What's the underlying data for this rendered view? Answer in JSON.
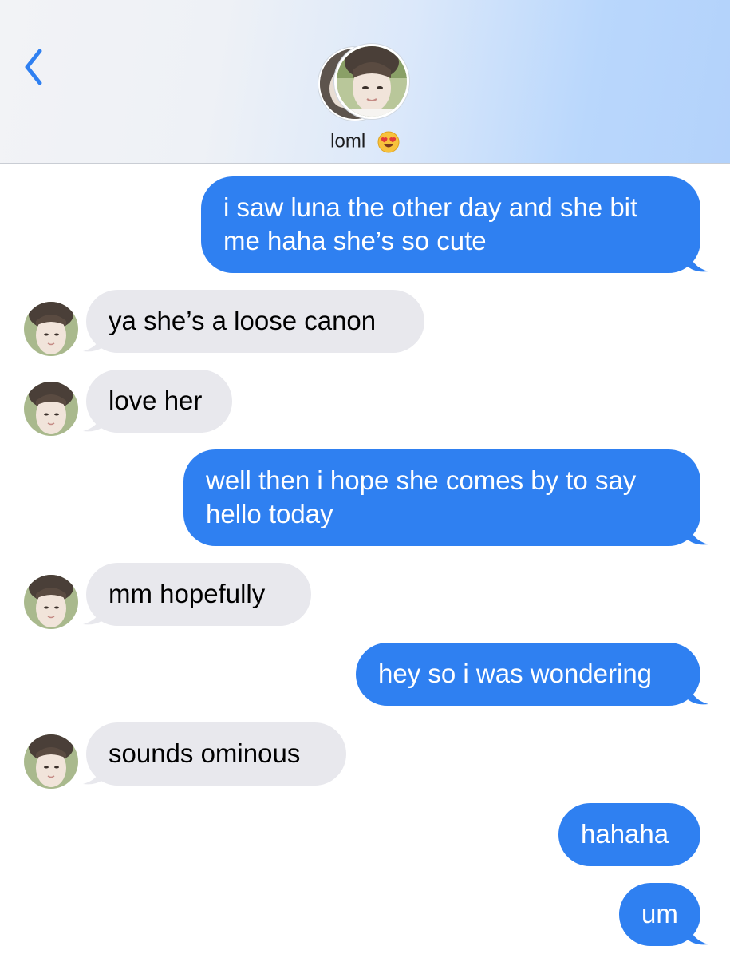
{
  "header": {
    "back_icon": "chevron-left-icon",
    "contact_name": "loml",
    "contact_emoji": "heart-eyes-emoji",
    "accent_color": "#2f80f1"
  },
  "messages": [
    {
      "id": "m1",
      "direction": "outgoing",
      "lines": [
        "i saw luna the other day and she bit",
        "me haha she’s so cute"
      ]
    },
    {
      "id": "m2",
      "direction": "incoming",
      "lines": [
        "ya she’s a loose canon"
      ]
    },
    {
      "id": "m3",
      "direction": "incoming",
      "lines": [
        "love her"
      ]
    },
    {
      "id": "m4",
      "direction": "outgoing",
      "lines": [
        "well then i hope she comes by to say",
        "hello today"
      ]
    },
    {
      "id": "m5",
      "direction": "incoming",
      "lines": [
        "mm hopefully"
      ]
    },
    {
      "id": "m6",
      "direction": "outgoing",
      "lines": [
        "hey so i was wondering"
      ]
    },
    {
      "id": "m7",
      "direction": "incoming",
      "lines": [
        "sounds ominous"
      ]
    },
    {
      "id": "m8",
      "direction": "outgoing",
      "lines": [
        "hahaha"
      ]
    },
    {
      "id": "m9",
      "direction": "outgoing",
      "lines": [
        "um"
      ]
    }
  ],
  "colors": {
    "outgoing_bubble": "#2f80f1",
    "incoming_bubble": "#e8e8ed",
    "outgoing_text": "#ffffff",
    "incoming_text": "#000000"
  }
}
